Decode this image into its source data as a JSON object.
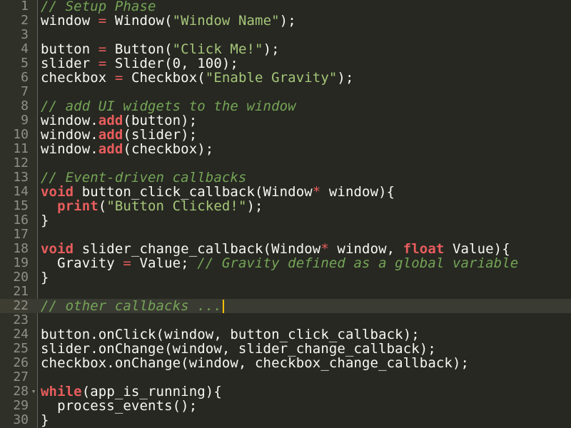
{
  "editor": {
    "active_line": 22,
    "colors": {
      "background": "#272822",
      "comment": "#75a557",
      "string": "#a6c779",
      "keyword": "#e85d5d",
      "cursor": "#f5c000"
    },
    "lines": [
      {
        "n": "1",
        "tokens": [
          [
            "cm",
            "// Setup Phase"
          ]
        ]
      },
      {
        "n": "2",
        "tokens": [
          [
            "",
            "window "
          ],
          [
            "op",
            "="
          ],
          [
            "",
            " Window("
          ],
          [
            "st",
            "\"Window Name\""
          ],
          [
            "",
            ");"
          ]
        ]
      },
      {
        "n": "3",
        "tokens": []
      },
      {
        "n": "4",
        "tokens": [
          [
            "",
            "button "
          ],
          [
            "op",
            "="
          ],
          [
            "",
            " Button("
          ],
          [
            "st",
            "\"Click Me!\""
          ],
          [
            "",
            ");"
          ]
        ]
      },
      {
        "n": "5",
        "tokens": [
          [
            "",
            "slider "
          ],
          [
            "op",
            "="
          ],
          [
            "",
            " Slider(0, 100);"
          ]
        ]
      },
      {
        "n": "6",
        "tokens": [
          [
            "",
            "checkbox "
          ],
          [
            "op",
            "="
          ],
          [
            "",
            " Checkbox("
          ],
          [
            "st",
            "\"Enable Gravity\""
          ],
          [
            "",
            ");"
          ]
        ]
      },
      {
        "n": "7",
        "tokens": []
      },
      {
        "n": "8",
        "tokens": [
          [
            "cm",
            "// add UI widgets to the window"
          ]
        ]
      },
      {
        "n": "9",
        "tokens": [
          [
            "",
            "window."
          ],
          [
            "kw",
            "add"
          ],
          [
            "",
            "(button);"
          ]
        ]
      },
      {
        "n": "10",
        "tokens": [
          [
            "",
            "window."
          ],
          [
            "kw",
            "add"
          ],
          [
            "",
            "(slider);"
          ]
        ]
      },
      {
        "n": "11",
        "tokens": [
          [
            "",
            "window."
          ],
          [
            "kw",
            "add"
          ],
          [
            "",
            "(checkbox);"
          ]
        ]
      },
      {
        "n": "12",
        "tokens": []
      },
      {
        "n": "13",
        "tokens": [
          [
            "cm",
            "// Event-driven callbacks"
          ]
        ]
      },
      {
        "n": "14",
        "tokens": [
          [
            "kw",
            "void"
          ],
          [
            "",
            " button_click_callback(Window"
          ],
          [
            "op",
            "*"
          ],
          [
            "",
            " window){"
          ]
        ]
      },
      {
        "n": "15",
        "tokens": [
          [
            "",
            "  "
          ],
          [
            "kw",
            "print"
          ],
          [
            "",
            "("
          ],
          [
            "st",
            "\"Button Clicked!\""
          ],
          [
            "",
            ");"
          ]
        ]
      },
      {
        "n": "16",
        "tokens": [
          [
            "",
            "}"
          ]
        ]
      },
      {
        "n": "17",
        "tokens": []
      },
      {
        "n": "18",
        "tokens": [
          [
            "kw",
            "void"
          ],
          [
            "",
            " slider_change_callback(Window"
          ],
          [
            "op",
            "*"
          ],
          [
            "",
            " window, "
          ],
          [
            "kw",
            "float"
          ],
          [
            "",
            " Value){"
          ]
        ]
      },
      {
        "n": "19",
        "tokens": [
          [
            "",
            "  Gravity "
          ],
          [
            "op",
            "="
          ],
          [
            "",
            " Value; "
          ],
          [
            "cm",
            "// Gravity defined as a global variable"
          ]
        ]
      },
      {
        "n": "20",
        "tokens": [
          [
            "",
            "}"
          ]
        ]
      },
      {
        "n": "21",
        "tokens": []
      },
      {
        "n": "22",
        "tokens": [
          [
            "cm",
            "// other callbacks ..."
          ]
        ]
      },
      {
        "n": "23",
        "tokens": []
      },
      {
        "n": "24",
        "tokens": [
          [
            "",
            "button.onClick(window, button_click_callback);"
          ]
        ]
      },
      {
        "n": "25",
        "tokens": [
          [
            "",
            "slider.onChange(window, slider_change_callback);"
          ]
        ]
      },
      {
        "n": "26",
        "tokens": [
          [
            "",
            "checkbox.onChange(window, checkbox_change_callback);"
          ]
        ]
      },
      {
        "n": "27",
        "tokens": []
      },
      {
        "n": "28",
        "tokens": [
          [
            "kw",
            "while"
          ],
          [
            "",
            "(app_is_running){"
          ]
        ]
      },
      {
        "n": "29",
        "tokens": [
          [
            "",
            "  process_events();"
          ]
        ]
      },
      {
        "n": "30",
        "tokens": [
          [
            "",
            "}"
          ]
        ]
      }
    ],
    "fold_markers": [
      {
        "line": 28,
        "icon": "fold-arrow-icon",
        "glyph": "▾"
      }
    ]
  }
}
